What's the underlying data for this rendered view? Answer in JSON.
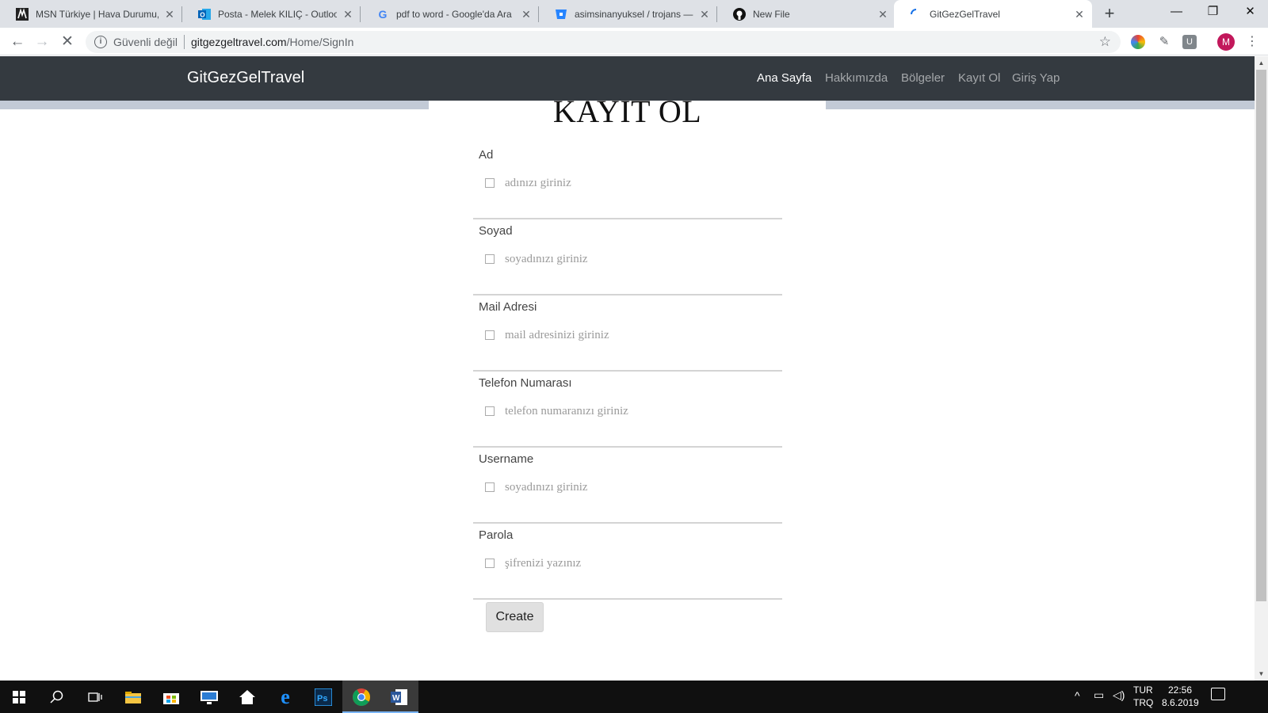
{
  "browser": {
    "tabs": [
      {
        "title": "MSN Türkiye | Hava Durumu, S",
        "favicon": "msn-icon"
      },
      {
        "title": "Posta - Melek KILIÇ - Outlook",
        "favicon": "outlook-icon"
      },
      {
        "title": "pdf to word - Google'da Ara",
        "favicon": "google-icon"
      },
      {
        "title": "asimsinanyuksel / trojans — Bit",
        "favicon": "bitbucket-icon"
      },
      {
        "title": "New File",
        "favicon": "github-icon"
      },
      {
        "title": "GitGezGelTravel",
        "favicon": "loading-icon",
        "active": true
      }
    ],
    "new_tab_label": "+",
    "address": {
      "security_label": "Güvenli değil",
      "host": "gitgezgeltravel.com",
      "path": "/Home/SignIn"
    },
    "profile_initial": "M"
  },
  "site": {
    "brand": "GitGezGelTravel",
    "nav": [
      {
        "label": "Ana Sayfa",
        "active": true
      },
      {
        "label": "Hakkımızda"
      },
      {
        "label": "Bölgeler"
      },
      {
        "label": "Kayıt Ol"
      },
      {
        "label": "Giriş Yap"
      }
    ]
  },
  "form": {
    "heading": "KAYIT OL",
    "fields": [
      {
        "label": "Ad",
        "placeholder": "adınızı giriniz",
        "value": ""
      },
      {
        "label": "Soyad",
        "placeholder": "soyadınızı giriniz",
        "value": ""
      },
      {
        "label": "Mail Adresi",
        "placeholder": "mail adresinizi giriniz",
        "value": ""
      },
      {
        "label": "Telefon Numarası",
        "placeholder": "telefon numaranızı giriniz",
        "value": ""
      },
      {
        "label": "Username",
        "placeholder": "soyadınızı giriniz",
        "value": ""
      },
      {
        "label": "Parola",
        "placeholder": "şifrenizi yazınız",
        "value": ""
      }
    ],
    "submit_label": "Create"
  },
  "taskbar": {
    "language": "TUR",
    "keyboard": "TRQ",
    "time": "22:56",
    "date": "8.6.2019"
  },
  "colors": {
    "navbar_bg": "#343a40",
    "band": "#c2cad6",
    "button_bg": "#e0e0e0"
  }
}
